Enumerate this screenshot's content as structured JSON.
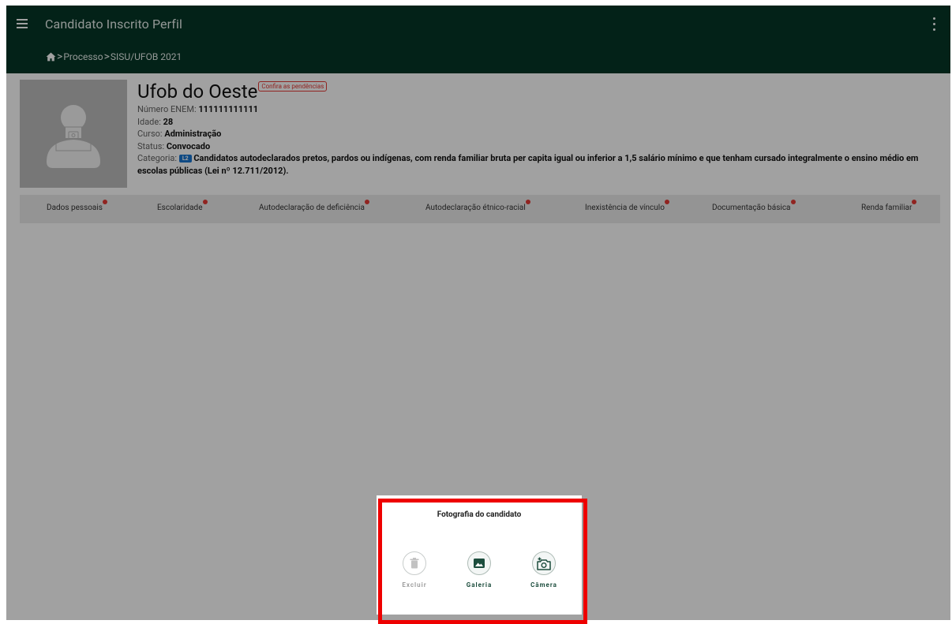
{
  "appbar": {
    "title": "Candidato Inscrito Perfil",
    "menu_icon": "hamburger-menu-icon",
    "more_icon": "more-vert-icon",
    "color": "#053626"
  },
  "breadcrumb": {
    "home_icon": "home-icon",
    "items": [
      "Processo",
      "SISU/UFOB 2021"
    ],
    "separator": ">"
  },
  "profile": {
    "name": "Ufob do Oeste",
    "pending_badge": "Confira as pendências",
    "enem_label": "Número ENEM:",
    "enem_value": "111111111111",
    "age_label": "Idade:",
    "age_value": "28",
    "course_label": "Curso:",
    "course_value": "Administração",
    "status_label": "Status:",
    "status_value": "Convocado",
    "category_label": "Categoria:",
    "category_code": "L2",
    "category_value": "Candidatos autodeclarados pretos, pardos ou indígenas, com renda familiar bruta per capita igual ou inferior a 1,5 salário mínimo e que tenham cursado integralmente o ensino médio em escolas públicas (Lei nº 12.711/2012)."
  },
  "tabs": [
    {
      "label": "Dados pessoais"
    },
    {
      "label": "Escolaridade"
    },
    {
      "label": "Autodeclaração de deficiência"
    },
    {
      "label": "Autodeclaração étnico-racial"
    },
    {
      "label": "Inexistência de vínculo"
    },
    {
      "label": "Documentação básica"
    },
    {
      "label": "Renda familiar"
    }
  ],
  "photo_sheet": {
    "title": "Fotografia do candidato",
    "actions": [
      {
        "label": "Excluir",
        "icon": "trash-icon",
        "enabled": false
      },
      {
        "label": "Galeria",
        "icon": "gallery-icon",
        "enabled": true
      },
      {
        "label": "Câmera",
        "icon": "add-camera-icon",
        "enabled": true
      }
    ]
  },
  "colors": {
    "accent": "#053626",
    "pending": "#e53935",
    "highlight": "#ee0000"
  }
}
